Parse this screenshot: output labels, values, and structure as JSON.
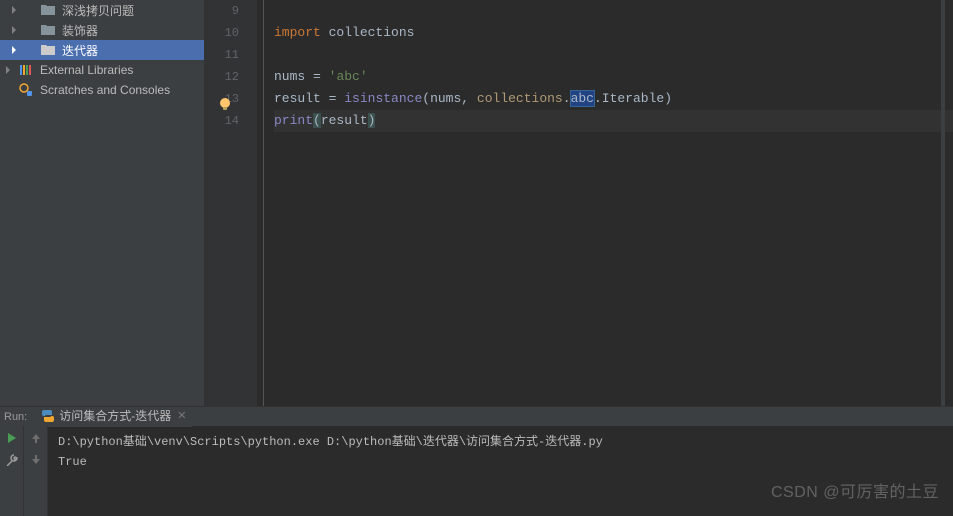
{
  "sidebar": {
    "items": [
      {
        "label": "深浅拷贝问题"
      },
      {
        "label": "装饰器"
      },
      {
        "label": "迭代器"
      }
    ],
    "external_libraries": "External Libraries",
    "scratches": "Scratches and Consoles"
  },
  "gutter": {
    "lines": [
      "9",
      "10",
      "11",
      "12",
      "13",
      "14"
    ]
  },
  "code": {
    "l9": "",
    "l10": {
      "kw": "import",
      "sp": " ",
      "mod": "collections"
    },
    "l11": "",
    "l12": {
      "var": "nums",
      "sp1": " ",
      "eq": "=",
      "sp2": " ",
      "str": "'abc'"
    },
    "l13": {
      "var": "result",
      "sp1": " ",
      "eq": "=",
      "sp2": " ",
      "fn": "isinstance",
      "op": "(",
      "arg1": "nums",
      "comma": ",",
      "sp3": " ",
      "mod": "collections",
      "dot1": ".",
      "abc": "abc",
      "dot2": ".",
      "it": "Iterable",
      "cp": ")"
    },
    "l14": {
      "fn": "print",
      "op": "(",
      "arg": "result",
      "cp": ")"
    }
  },
  "run_header": {
    "label": "Run:",
    "tab": "访问集合方式-迭代器"
  },
  "console": {
    "cmd": "D:\\python基础\\venv\\Scripts\\python.exe D:\\python基础\\迭代器\\访问集合方式-迭代器.py",
    "out": "True"
  },
  "watermark": "CSDN @可厉害的土豆"
}
